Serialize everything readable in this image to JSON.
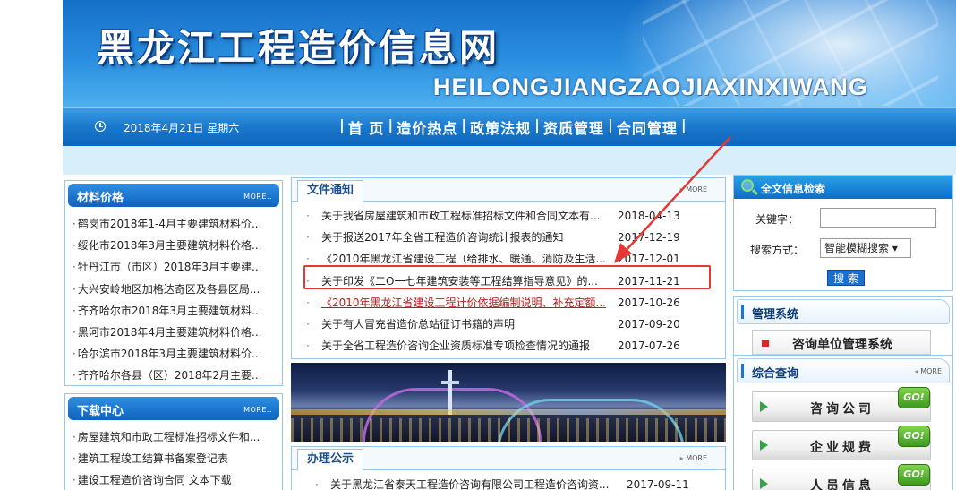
{
  "banner": {
    "title": "黑龙江工程造价信息网",
    "subtitle": "HEILONGJIANGZAOJIAXINXIWANG"
  },
  "navbar": {
    "date": "2018年4月21日 星期六",
    "menu": [
      "首 页",
      "造价热点",
      "政策法规",
      "资质管理",
      "合同管理"
    ],
    "separator": "|"
  },
  "materials": {
    "title": "材料价格",
    "more": "MORE..",
    "items": [
      "鹤岗市2018年1-4月主要建筑材料价...",
      "绥化市2018年3月主要建筑材料价格...",
      "牡丹江市（市区）2018年3月主要建...",
      "大兴安岭地区加格达奇区及各县区局...",
      "齐齐哈尔市2018年3月主要建筑材料...",
      "黑河市2018年4月主要建筑材料价格...",
      "哈尔滨市2018年3月主要建筑材料价...",
      "齐齐哈尔各县（区）2018年2月主要..."
    ]
  },
  "downloads": {
    "title": "下载中心",
    "more": "MORE..",
    "items": [
      "房屋建筑和市政工程标准招标文件和...",
      "建筑工程竣工结算书备案登记表",
      "建设工程造价咨询合同 文本下载"
    ]
  },
  "notices": {
    "tab": "文件通知",
    "more": "MORE",
    "items": [
      {
        "text": "关于我省房屋建筑和市政工程标准招标文件和合同文本有...",
        "date": "2018-04-13"
      },
      {
        "text": "关于报送2017年全省工程造价咨询统计报表的通知",
        "date": "2017-12-19"
      },
      {
        "text": "《2010年黑龙江省建设工程（给排水、暖通、消防及生活...",
        "date": "2017-12-01"
      },
      {
        "text": "关于印发《二O一七年建筑安装等工程结算指导意见》的...",
        "date": "2017-11-21"
      },
      {
        "text": "《2010年黑龙江省建设工程计价依据编制说明、补充定额...",
        "date": "2017-10-26"
      },
      {
        "text": "关于有人冒充省造价总站征订书籍的声明",
        "date": "2017-09-20"
      },
      {
        "text": "关于全省工程造价咨询企业资质标准专项检查情况的通报",
        "date": "2017-07-26"
      }
    ],
    "bullet": "·"
  },
  "publicity": {
    "tab": "办理公示",
    "more": "MORE",
    "items": [
      {
        "text": "关于黑龙江省泰天工程造价咨询有限公司工程造价咨询资...",
        "date": "2017-09-11"
      }
    ]
  },
  "search": {
    "title": "全文信息检索",
    "keyword_label": "关键字：",
    "keyword_value": "",
    "mode_label": "搜索方式：",
    "mode_value": "智能模糊搜索 ▾",
    "button": "搜 索"
  },
  "management": {
    "title": "管理系统",
    "button": "咨询单位管理系统"
  },
  "query": {
    "title": "综合查询",
    "more": "MORE",
    "buttons": [
      "咨询公司",
      "企业规费",
      "人员信息"
    ],
    "go": "GO!"
  },
  "colors": {
    "accent": "#1a78cc",
    "highlight": "#e53935",
    "link_red": "#b71c1c"
  }
}
